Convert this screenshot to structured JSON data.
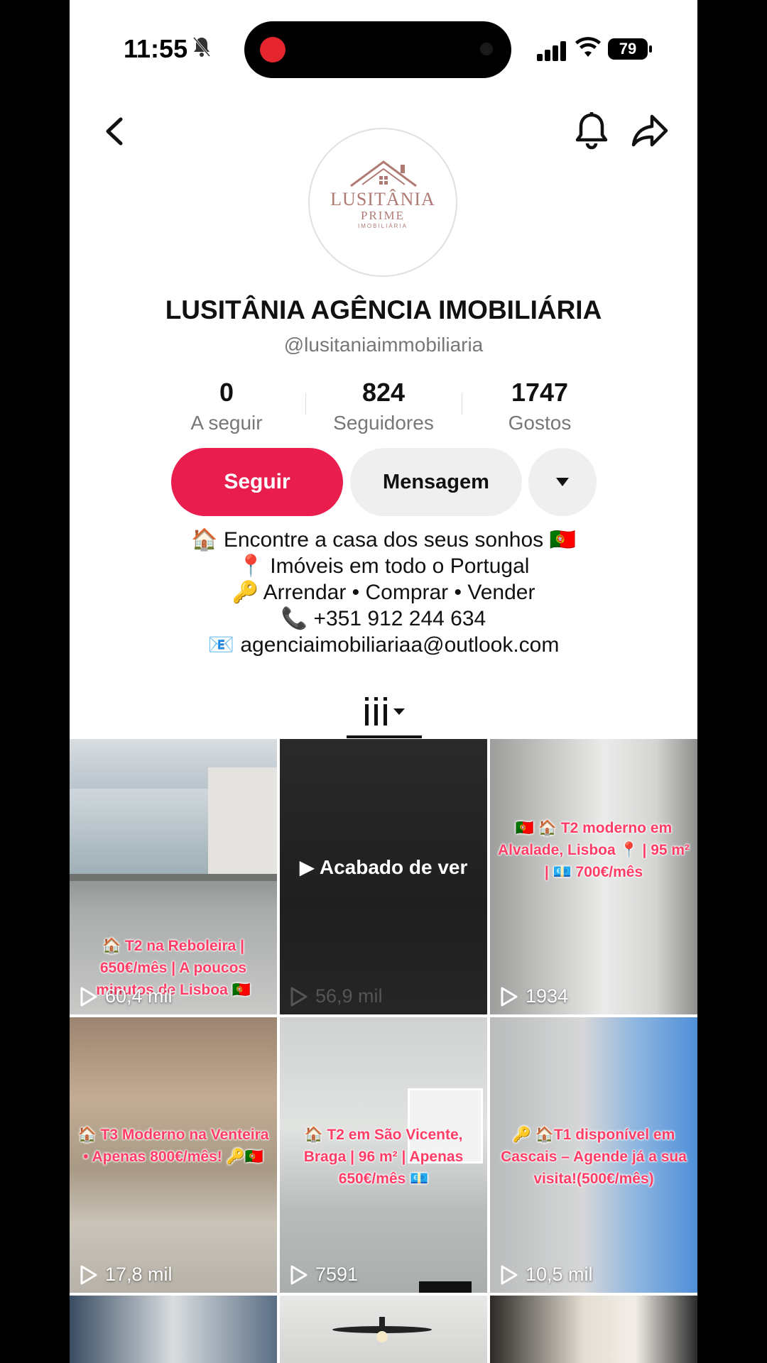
{
  "status_bar": {
    "time": "11:55",
    "battery": "79"
  },
  "profile": {
    "avatar_line1": "LUSITÂNIA",
    "avatar_line2": "PRIME",
    "avatar_line3": "IMOBILIÁRIA",
    "name": "LUSITÂNIA AGÊNCIA IMOBILIÁRIA",
    "handle": "@lusitaniaimmobiliaria"
  },
  "stats": [
    {
      "value": "0",
      "label": "A seguir"
    },
    {
      "value": "824",
      "label": "Seguidores"
    },
    {
      "value": "1747",
      "label": "Gostos"
    }
  ],
  "actions": {
    "follow": "Seguir",
    "message": "Mensagem"
  },
  "bio": [
    "🏠 Encontre a casa dos seus sonhos 🇵🇹",
    "📍 Imóveis em todo o Portugal",
    "🔑 Arrendar • Comprar • Vender",
    "📞 +351 912 244 634",
    "📧 agenciaimobiliariaa@outlook.com"
  ],
  "videos": [
    {
      "caption": "🏠 T2 na Reboleira | 650€/mês | A poucos minutos de Lisboa 🇵🇹",
      "views": "60,4 mil"
    },
    {
      "caption": "",
      "views": "56,9 mil",
      "watched": "▶ Acabado de ver"
    },
    {
      "caption": "🇵🇹 🏠 T2 moderno em Alvalade, Lisboa 📍 | 95 m² | 💶 700€/mês",
      "views": "1934"
    },
    {
      "caption": "🏠 T3 Moderno na Venteira • Apenas 800€/mês! 🔑🇵🇹",
      "views": "17,8 mil"
    },
    {
      "caption": "🏠 T2 em São Vicente, Braga | 96 m² | Apenas 650€/mês 💶",
      "views": "7591"
    },
    {
      "caption": "🔑 🏠T1 disponível em Cascais – Agende já a sua visita!(500€/mês)",
      "views": "10,5 mil"
    }
  ]
}
